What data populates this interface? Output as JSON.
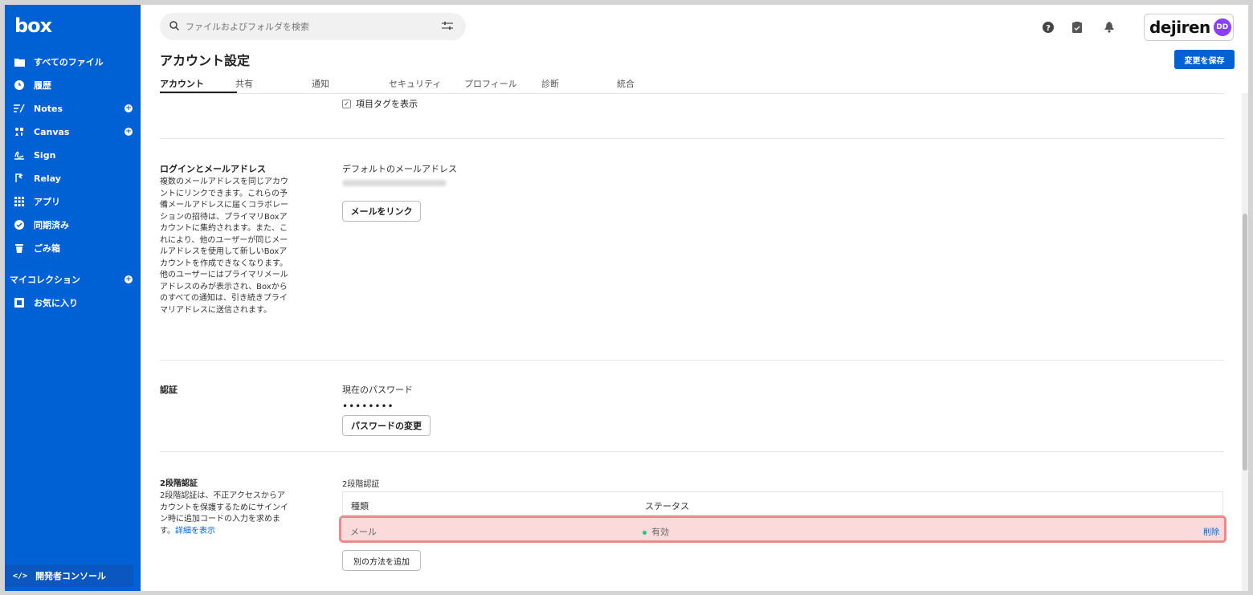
{
  "sidebar": {
    "logo": "box",
    "items": [
      {
        "label": "すべてのファイル",
        "icon": "folder-icon"
      },
      {
        "label": "履歴",
        "icon": "clock-icon"
      },
      {
        "label": "Notes",
        "icon": "notes-icon"
      },
      {
        "label": "Canvas",
        "icon": "canvas-icon"
      },
      {
        "label": "Sign",
        "icon": "sign-icon"
      },
      {
        "label": "Relay",
        "icon": "relay-icon"
      },
      {
        "label": "アプリ",
        "icon": "apps-grid-icon"
      },
      {
        "label": "同期済み",
        "icon": "check-circle-icon"
      },
      {
        "label": "ごみ箱",
        "icon": "trash-icon"
      }
    ],
    "collections_label": "マイコレクション",
    "favorites_label": "お気に入り",
    "dev_console_label": "開発者コンソール"
  },
  "header": {
    "search_placeholder": "ファイルおよびフォルダを検索",
    "brand": "dejiren",
    "avatar_initials": "DD"
  },
  "page": {
    "title": "アカウント設定",
    "save_label": "変更を保存",
    "tabs": [
      "アカウント",
      "共有",
      "通知",
      "セキュリティ",
      "プロフィール",
      "診断",
      "統合"
    ]
  },
  "item_tags": {
    "label": "項目タグを表示"
  },
  "login_section": {
    "title": "ログインとメールアドレス",
    "description": "複数のメールアドレスを同じアカウントにリンクできます。これらの予備メールアドレスに届くコラボレーションの招待は、プライマリBoxアカウントに集約されます。また、これにより、他のユーザーが同じメールアドレスを使用して新しいBoxアカウントを作成できなくなります。他のユーザーにはプライマリメールアドレスのみが表示され、Boxからのすべての通知は、引き続きプライマリアドレスに送信されます。",
    "default_email_label": "デフォルトのメールアドレス",
    "link_email_button": "メールをリンク"
  },
  "auth_section": {
    "title": "認証",
    "current_password_label": "現在のパスワード",
    "password_mask": "••••••••",
    "change_password_button": "パスワードの変更"
  },
  "two_factor_section": {
    "title": "2段階認証",
    "description": "2段階認証は、不正アクセスからアカウントを保護するためにサインイン時に追加コードの入力を求めます。",
    "details_link": "詳細を表示",
    "table_title": "2段階認証",
    "col_type": "種類",
    "col_status": "ステータス",
    "rows": [
      {
        "type": "メール",
        "status": "有効",
        "action": "削除"
      }
    ],
    "add_method_button": "別の方法を追加"
  }
}
